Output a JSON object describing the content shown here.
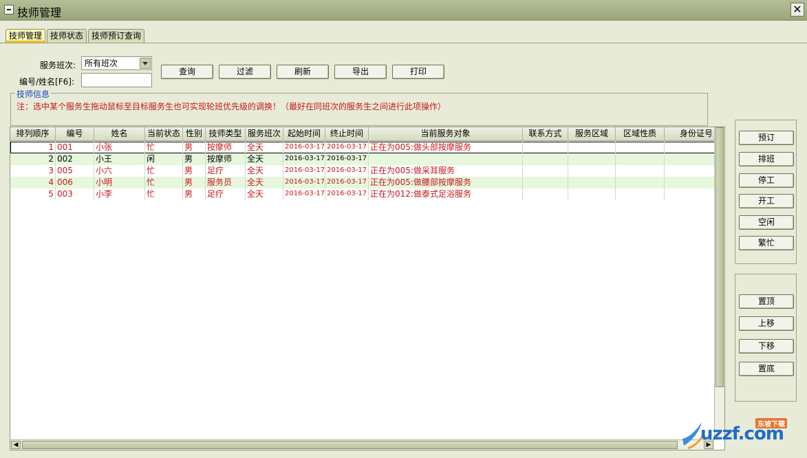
{
  "window": {
    "title": "技师管理",
    "close_label": "✕"
  },
  "tabs": [
    {
      "label": "技师管理",
      "active": true
    },
    {
      "label": "技师状态",
      "active": false
    },
    {
      "label": "技师预订查询",
      "active": false
    }
  ],
  "filters": {
    "shift_label": "服务班次:",
    "shift_value": "所有班次",
    "id_label": "编号/姓名[F6]:",
    "id_value": ""
  },
  "toolbar": {
    "query": "查询",
    "filter": "过滤",
    "refresh": "刷新",
    "export": "导出",
    "print": "打印"
  },
  "info_group": {
    "title": "技师信息",
    "note": "注：选中某个服务生拖动鼠标至目标服务生也可实现轮班优先级的调换！（最好在同班次的服务生之间进行此项操作）"
  },
  "table": {
    "columns": [
      "排列顺序",
      "编号",
      "姓名",
      "当前状态",
      "性别",
      "技师类型",
      "服务班次",
      "起始时间",
      "终止时间",
      "当前服务对象",
      "联系方式",
      "服务区域",
      "区域性质",
      "身份证号"
    ],
    "rows": [
      {
        "order": "1",
        "id": "001",
        "name": "小张",
        "status": "忙",
        "gender": "男",
        "type": "按摩师",
        "shift": "全天",
        "start": "2016-03-17",
        "end": "2016-03-17",
        "target": "正在为005:做头部按摩服务",
        "contact": "",
        "area": "",
        "area_type": "",
        "idcard": ""
      },
      {
        "order": "2",
        "id": "002",
        "name": "小王",
        "status": "闲",
        "gender": "男",
        "type": "按摩师",
        "shift": "全天",
        "start": "2016-03-17",
        "end": "2016-03-17",
        "target": "",
        "contact": "",
        "area": "",
        "area_type": "",
        "idcard": ""
      },
      {
        "order": "3",
        "id": "005",
        "name": "小六",
        "status": "忙",
        "gender": "男",
        "type": "足疗",
        "shift": "全天",
        "start": "2016-03-17",
        "end": "2016-03-17",
        "target": "正在为005:做采耳服务",
        "contact": "",
        "area": "",
        "area_type": "",
        "idcard": ""
      },
      {
        "order": "4",
        "id": "006",
        "name": "小明",
        "status": "忙",
        "gender": "男",
        "type": "服务员",
        "shift": "全天",
        "start": "2016-03-17",
        "end": "2016-03-17",
        "target": "正在为005:做腰部按摩服务",
        "contact": "",
        "area": "",
        "area_type": "",
        "idcard": ""
      },
      {
        "order": "5",
        "id": "003",
        "name": "小李",
        "status": "忙",
        "gender": "男",
        "type": "足疗",
        "shift": "全天",
        "start": "2016-03-17",
        "end": "2016-03-17",
        "target": "正在为012:做泰式足浴服务",
        "contact": "",
        "area": "",
        "area_type": "",
        "idcard": ""
      }
    ]
  },
  "side_buttons_top": [
    "预订",
    "排班",
    "停工",
    "开工",
    "空闲",
    "繁忙"
  ],
  "side_buttons_bottom": [
    "置顶",
    "上移",
    "下移",
    "置底"
  ],
  "watermark": {
    "text": "uzzf.com",
    "sub": "东坡下载"
  },
  "colors": {
    "busy_text": "#c8181b",
    "alt_row": "#e6f7de",
    "window_bg": "#e7ebd7",
    "group_title": "#1d3fbf"
  }
}
